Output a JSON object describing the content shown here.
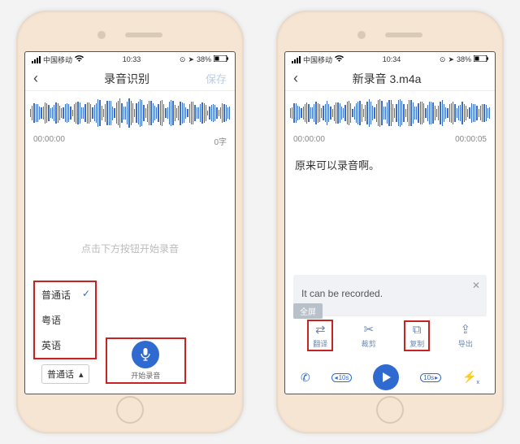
{
  "phone1": {
    "status": {
      "carrier": "中国移动",
      "time": "10:33",
      "battery": "38%"
    },
    "nav": {
      "title": "录音识别",
      "save": "保存"
    },
    "time_start": "00:00:00",
    "word_count": "0字",
    "hint": "点击下方按钮开始录音",
    "lang_options": [
      "普通话",
      "粤语",
      "英语"
    ],
    "lang_selected": "普通话",
    "rec_label": "开始录音"
  },
  "phone2": {
    "status": {
      "carrier": "中国移动",
      "time": "10:34",
      "battery": "38%"
    },
    "nav": {
      "title": "新录音 3.m4a",
      "save": ""
    },
    "time_start": "00:00:00",
    "time_end": "00:00:05",
    "transcript": "原来可以录音啊。",
    "translation": "It can be recorded.",
    "fullscreen": "全屏",
    "tools": {
      "translate": "翻译",
      "cut": "裁剪",
      "copy": "复制",
      "export": "导出"
    },
    "skip": "10s"
  }
}
